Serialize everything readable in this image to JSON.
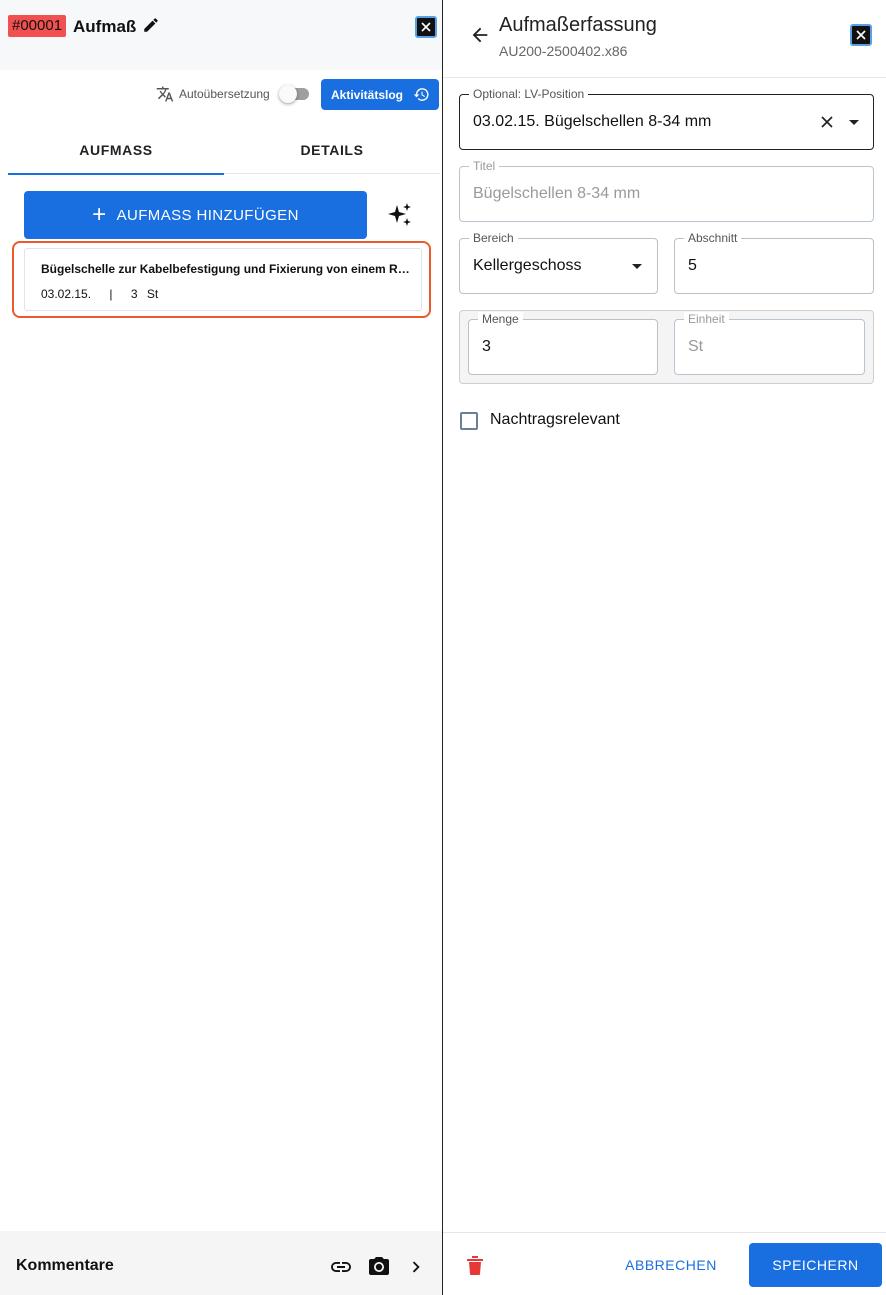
{
  "left": {
    "header": {
      "id_badge": "#00001",
      "title": "Aufmaß",
      "edit_icon": "pencil-icon",
      "close_icon": "close-icon"
    },
    "toolbar": {
      "auto_translate_label": "Autoübersetzung",
      "auto_translate_on": false,
      "activity_button": "Aktivitätslog"
    },
    "tabs": [
      {
        "label": "AUFMASS",
        "active": true
      },
      {
        "label": "DETAILS",
        "active": false
      }
    ],
    "add_button": {
      "icon": "+",
      "label": "AUFMASS HINZUFÜGEN"
    },
    "items": [
      {
        "title": "Bügelschelle zur Kabelbefestigung und Fixierung von einem Rohr",
        "position": "03.02.15.",
        "separator": "|",
        "quantity": "3",
        "unit": "St"
      }
    ],
    "comments": {
      "label": "Kommentare"
    }
  },
  "right": {
    "header": {
      "title": "Aufmaßerfassung",
      "subtitle": "AU200-2500402.x86"
    },
    "fields": {
      "lv_position": {
        "label": "Optional: LV-Position",
        "value": "03.02.15. Bügelschellen 8-34 mm"
      },
      "titel": {
        "label": "Titel",
        "value": "Bügelschellen 8-34 mm"
      },
      "bereich": {
        "label": "Bereich",
        "value": "Kellergeschoss"
      },
      "abschnitt": {
        "label": "Abschnitt",
        "value": "5"
      },
      "menge": {
        "label": "Menge",
        "value": "3"
      },
      "einheit": {
        "label": "Einheit",
        "value": "St"
      }
    },
    "checkbox": {
      "label": "Nachtragsrelevant",
      "checked": false
    },
    "footer": {
      "cancel": "ABBRECHEN",
      "save": "SPEICHERN"
    }
  },
  "colors": {
    "accent": "#1a6fe0",
    "badge": "#f0504f",
    "highlight": "#ea5a2b",
    "delete": "#e53935"
  }
}
